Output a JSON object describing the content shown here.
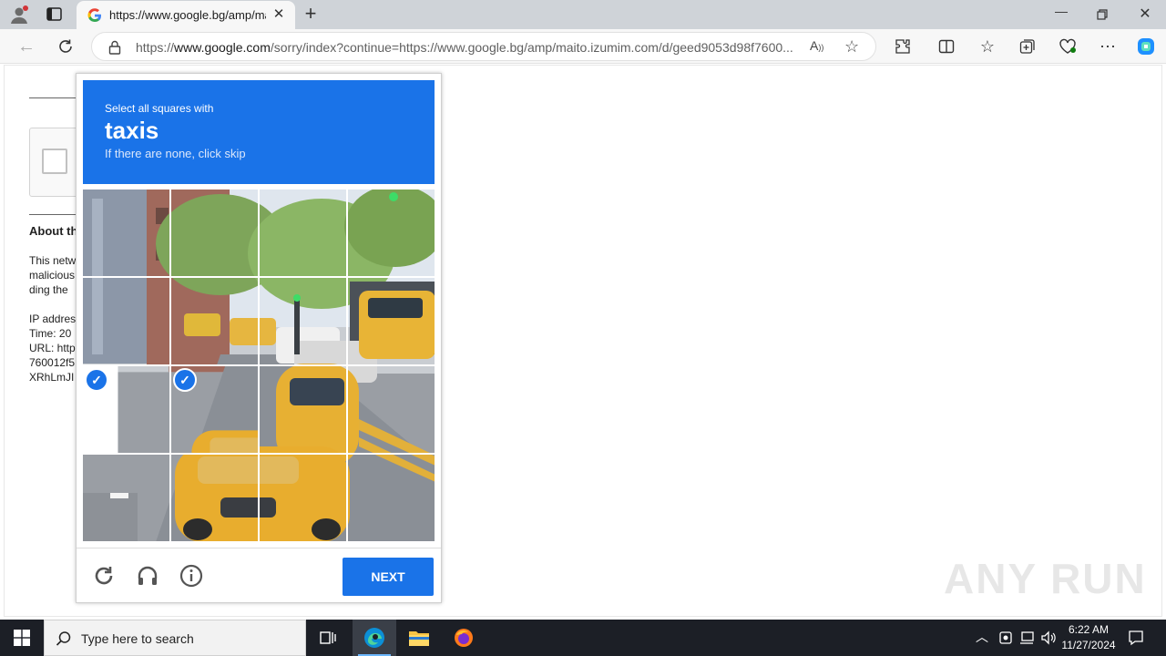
{
  "browser": {
    "tab_title": "https://www.google.bg/amp/maito.izumim.com",
    "url_prefix": "https://",
    "url_domain": "www.google.com",
    "url_rest": "/sorry/index?continue=https://www.google.bg/amp/maito.izumim.com/d/geed9053d98f7600..."
  },
  "background_page": {
    "heading": "About th",
    "para1": [
      "This netw",
      "malicious",
      "ding the"
    ],
    "para2": [
      "IP addres",
      "Time: 20",
      "URL: http",
      "760012f5",
      "XRhLmJI"
    ]
  },
  "captcha": {
    "instruction": "Select all squares with",
    "target": "taxis",
    "hint": "If there are none, click skip",
    "selected_tiles": [
      8,
      9
    ],
    "next_label": "NEXT",
    "colors": {
      "accent": "#1a73e8"
    }
  },
  "watermark": "ANY RUN",
  "taskbar": {
    "search_placeholder": "Type here to search",
    "time": "6:22 AM",
    "date": "11/27/2024"
  }
}
